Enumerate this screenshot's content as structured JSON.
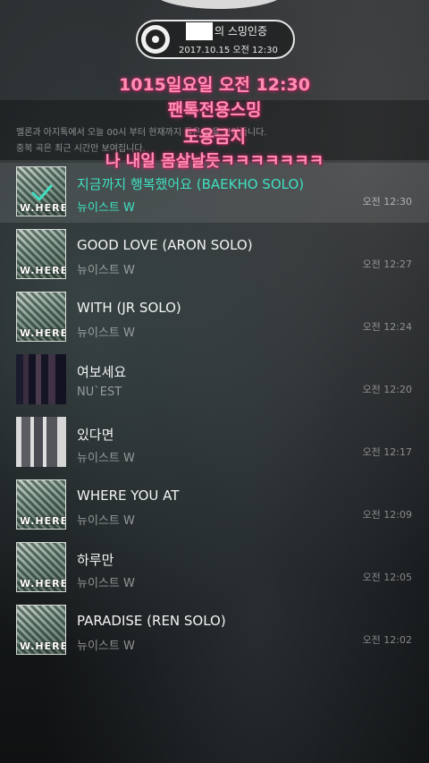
{
  "header": {
    "title_suffix": "의 스밍인증",
    "datetime": "2017.10.15 오전 12:30"
  },
  "notice": {
    "line1": "멜론과 아지톡에서 오늘 00시 부터 현재까지 들은 곡을 보여줍니다.",
    "line2": "중복 곡은 최근 시간만 보여집니다."
  },
  "overlay": {
    "line1": "1015일요일 오전 12:30",
    "line2": "팬톡전용스밍",
    "line3": "도용금지",
    "line4": "나 내일 몸살날듯ㅋㅋㅋㅋㅋㅋㅋ"
  },
  "tracks": [
    {
      "title": "지금까지 행복했어요 (BAEKHO SOLO)",
      "artist": "뉴이스트 W",
      "time": "오전 12:30",
      "art": "where",
      "selected": true
    },
    {
      "title": "GOOD LOVE (ARON SOLO)",
      "artist": "뉴이스트 W",
      "time": "오전 12:27",
      "art": "where",
      "selected": false
    },
    {
      "title": "WITH (JR SOLO)",
      "artist": "뉴이스트 W",
      "time": "오전 12:24",
      "art": "where",
      "selected": false
    },
    {
      "title": "여보세요",
      "artist": "NU`EST",
      "time": "오전 12:20",
      "art": "hello",
      "selected": false
    },
    {
      "title": "있다면",
      "artist": "뉴이스트 W",
      "time": "오전 12:17",
      "art": "ifyou",
      "selected": false
    },
    {
      "title": "WHERE YOU AT",
      "artist": "뉴이스트 W",
      "time": "오전 12:09",
      "art": "where",
      "selected": false
    },
    {
      "title": "하루만",
      "artist": "뉴이스트 W",
      "time": "오전 12:05",
      "art": "where",
      "selected": false
    },
    {
      "title": "PARADISE (REN SOLO)",
      "artist": "뉴이스트 W",
      "time": "오전 12:02",
      "art": "where",
      "selected": false
    }
  ],
  "album_watermark": "W.HERE",
  "colors": {
    "selected_text": "#3fe0c0",
    "overlay_text": "#ff8fb2"
  }
}
